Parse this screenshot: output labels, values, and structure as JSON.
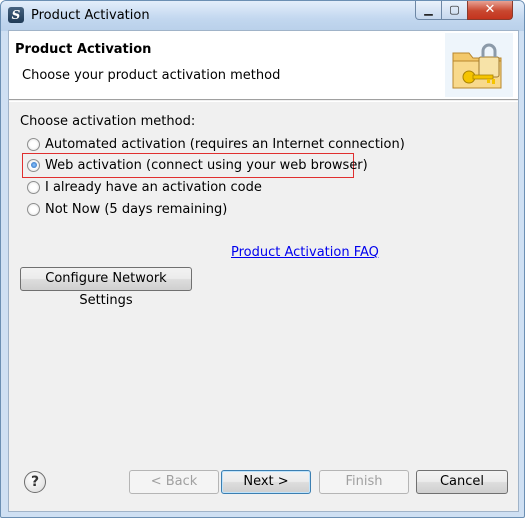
{
  "window": {
    "title": "Product Activation",
    "controls": {
      "minimize": "▁",
      "maximize": "▢",
      "close": "✕"
    }
  },
  "header": {
    "title": "Product Activation",
    "subtitle": "Choose your product activation method",
    "icon": "folder-lock-key-icon"
  },
  "method": {
    "label": "Choose activation method:",
    "options": [
      {
        "label": "Automated activation (requires an Internet connection)",
        "checked": false
      },
      {
        "label": "Web activation (connect using your web browser)",
        "checked": true
      },
      {
        "label": "I already have an activation code",
        "checked": false
      },
      {
        "label": "Not Now (5 days remaining)",
        "checked": false
      }
    ]
  },
  "faq_link": "Product Activation FAQ",
  "network_button": "Configure Network Settings",
  "footer": {
    "help": "?",
    "back": "< Back",
    "next": "Next >",
    "finish": "Finish",
    "cancel": "Cancel"
  },
  "colors": {
    "highlight_border": "#e02f2f",
    "link": "#0000ee",
    "close_button": "#c9472f"
  }
}
